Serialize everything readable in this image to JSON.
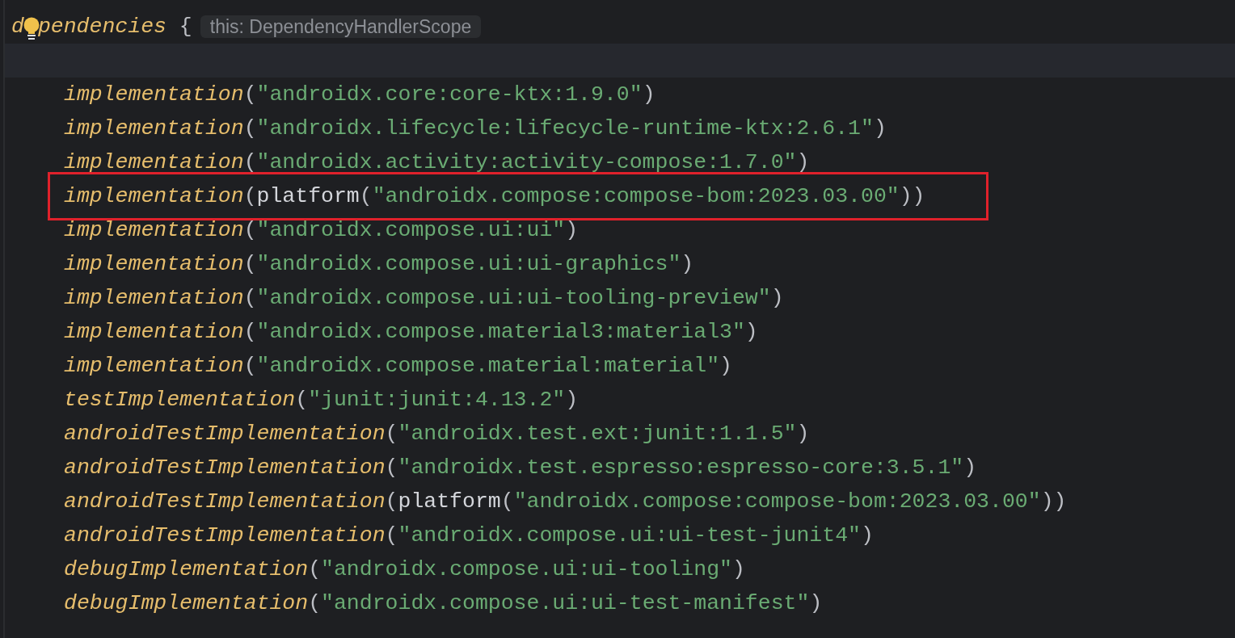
{
  "editor": {
    "lines": [
      {
        "kind": "code",
        "current": false,
        "boxed": false,
        "tokens": [
          {
            "kind": "function",
            "text": "d"
          },
          {
            "kind": "bulb_break"
          },
          {
            "kind": "function",
            "text": "pendencies"
          },
          {
            "kind": "punct",
            "text": " {"
          },
          {
            "kind": "hint",
            "text": "this: DependencyHandlerScope"
          }
        ],
        "children": [
          {
            "kind": "empty",
            "current": true,
            "boxed": false
          },
          {
            "kind": "code",
            "current": false,
            "boxed": false,
            "tokens": [
              {
                "kind": "function",
                "text": "implementation"
              },
              {
                "kind": "punct",
                "text": "("
              },
              {
                "kind": "string",
                "text": "\"androidx.core:core-ktx:1.9.0\""
              },
              {
                "kind": "punct",
                "text": ")"
              }
            ]
          },
          {
            "kind": "code",
            "current": false,
            "boxed": false,
            "tokens": [
              {
                "kind": "function",
                "text": "implementation"
              },
              {
                "kind": "punct",
                "text": "("
              },
              {
                "kind": "string",
                "text": "\"androidx.lifecycle:lifecycle-runtime-ktx:2.6.1\""
              },
              {
                "kind": "punct",
                "text": ")"
              }
            ]
          },
          {
            "kind": "code",
            "current": false,
            "boxed": false,
            "tokens": [
              {
                "kind": "function",
                "text": "implementation"
              },
              {
                "kind": "punct",
                "text": "("
              },
              {
                "kind": "string",
                "text": "\"androidx.activity:activity-compose:1.7.0\""
              },
              {
                "kind": "punct",
                "text": ")"
              }
            ]
          },
          {
            "kind": "code",
            "current": false,
            "boxed": true,
            "tokens": [
              {
                "kind": "function",
                "text": "implementation"
              },
              {
                "kind": "punct",
                "text": "("
              },
              {
                "kind": "call",
                "text": "platform"
              },
              {
                "kind": "punct",
                "text": "("
              },
              {
                "kind": "string",
                "text": "\"androidx.compose:compose-bom:2023.03.00\""
              },
              {
                "kind": "punct",
                "text": "))"
              }
            ]
          },
          {
            "kind": "code",
            "current": false,
            "boxed": false,
            "tokens": [
              {
                "kind": "function",
                "text": "implementation"
              },
              {
                "kind": "punct",
                "text": "("
              },
              {
                "kind": "string",
                "text": "\"androidx.compose.ui:ui\""
              },
              {
                "kind": "punct",
                "text": ")"
              }
            ]
          },
          {
            "kind": "code",
            "current": false,
            "boxed": false,
            "tokens": [
              {
                "kind": "function",
                "text": "implementation"
              },
              {
                "kind": "punct",
                "text": "("
              },
              {
                "kind": "string",
                "text": "\"androidx.compose.ui:ui-graphics\""
              },
              {
                "kind": "punct",
                "text": ")"
              }
            ]
          },
          {
            "kind": "code",
            "current": false,
            "boxed": false,
            "tokens": [
              {
                "kind": "function",
                "text": "implementation"
              },
              {
                "kind": "punct",
                "text": "("
              },
              {
                "kind": "string",
                "text": "\"androidx.compose.ui:ui-tooling-preview\""
              },
              {
                "kind": "punct",
                "text": ")"
              }
            ]
          },
          {
            "kind": "code",
            "current": false,
            "boxed": false,
            "tokens": [
              {
                "kind": "function",
                "text": "implementation"
              },
              {
                "kind": "punct",
                "text": "("
              },
              {
                "kind": "string",
                "text": "\"androidx.compose.material3:material3\""
              },
              {
                "kind": "punct",
                "text": ")"
              }
            ]
          },
          {
            "kind": "code",
            "current": false,
            "boxed": false,
            "tokens": [
              {
                "kind": "function",
                "text": "implementation"
              },
              {
                "kind": "punct",
                "text": "("
              },
              {
                "kind": "string",
                "text": "\"androidx.compose.material:material\""
              },
              {
                "kind": "punct",
                "text": ")"
              }
            ]
          },
          {
            "kind": "code",
            "current": false,
            "boxed": false,
            "tokens": [
              {
                "kind": "function",
                "text": "testImplementation"
              },
              {
                "kind": "punct",
                "text": "("
              },
              {
                "kind": "string",
                "text": "\"junit:junit:4.13.2\""
              },
              {
                "kind": "punct",
                "text": ")"
              }
            ]
          },
          {
            "kind": "code",
            "current": false,
            "boxed": false,
            "tokens": [
              {
                "kind": "function",
                "text": "androidTestImplementation"
              },
              {
                "kind": "punct",
                "text": "("
              },
              {
                "kind": "string",
                "text": "\"androidx.test.ext:junit:1.1.5\""
              },
              {
                "kind": "punct",
                "text": ")"
              }
            ]
          },
          {
            "kind": "code",
            "current": false,
            "boxed": false,
            "tokens": [
              {
                "kind": "function",
                "text": "androidTestImplementation"
              },
              {
                "kind": "punct",
                "text": "("
              },
              {
                "kind": "string",
                "text": "\"androidx.test.espresso:espresso-core:3.5.1\""
              },
              {
                "kind": "punct",
                "text": ")"
              }
            ]
          },
          {
            "kind": "code",
            "current": false,
            "boxed": false,
            "tokens": [
              {
                "kind": "function",
                "text": "androidTestImplementation"
              },
              {
                "kind": "punct",
                "text": "("
              },
              {
                "kind": "call",
                "text": "platform"
              },
              {
                "kind": "punct",
                "text": "("
              },
              {
                "kind": "string",
                "text": "\"androidx.compose:compose-bom:2023.03.00\""
              },
              {
                "kind": "punct",
                "text": "))"
              }
            ]
          },
          {
            "kind": "code",
            "current": false,
            "boxed": false,
            "tokens": [
              {
                "kind": "function",
                "text": "androidTestImplementation"
              },
              {
                "kind": "punct",
                "text": "("
              },
              {
                "kind": "string",
                "text": "\"androidx.compose.ui:ui-test-junit4\""
              },
              {
                "kind": "punct",
                "text": ")"
              }
            ]
          },
          {
            "kind": "code",
            "current": false,
            "boxed": false,
            "tokens": [
              {
                "kind": "function",
                "text": "debugImplementation"
              },
              {
                "kind": "punct",
                "text": "("
              },
              {
                "kind": "string",
                "text": "\"androidx.compose.ui:ui-tooling\""
              },
              {
                "kind": "punct",
                "text": ")"
              }
            ]
          },
          {
            "kind": "code",
            "current": false,
            "boxed": false,
            "tokens": [
              {
                "kind": "function",
                "text": "debugImplementation"
              },
              {
                "kind": "punct",
                "text": "("
              },
              {
                "kind": "string",
                "text": "\"androidx.compose.ui:ui-test-manifest\""
              },
              {
                "kind": "punct",
                "text": ")"
              }
            ]
          }
        ]
      }
    ]
  }
}
